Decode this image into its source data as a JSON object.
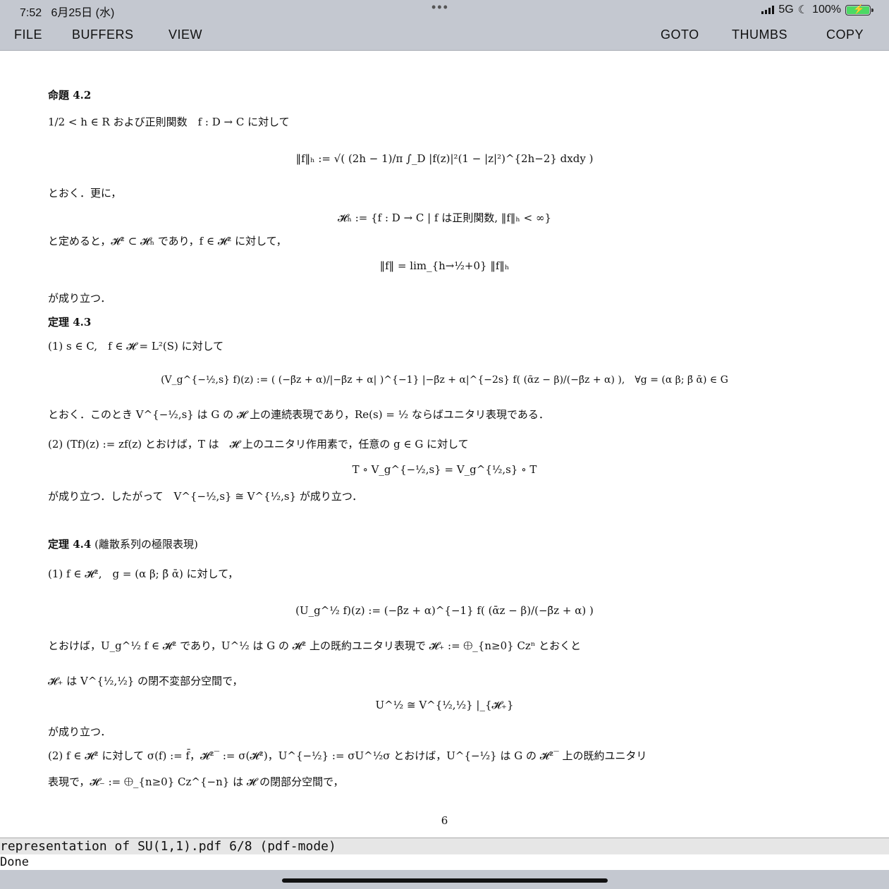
{
  "status": {
    "time": "7:52",
    "date": "6月25日 (水)",
    "network": "5G",
    "battery": "100%",
    "dots": "•••"
  },
  "menu": {
    "file": "FILE",
    "buffers": "BUFFERS",
    "view": "VIEW",
    "goto": "GOTO",
    "thumbs": "THUMBS",
    "copy": "COPY"
  },
  "doc": {
    "prop42_title": "命題 4.2",
    "prop42_line1": "1/2 < h ∈ R および正則関数　f : D → C に対して",
    "eq1": "‖f‖ₕ := √( (2h − 1)/π ∫_D |f(z)|²(1 − |z|²)^{2h−2} dxdy )",
    "text_okusarani": "とおく．更に，",
    "eq2": "𝓗ₕ := {f : D → C | f は正則関数, ‖f‖ₕ < ∞}",
    "text_sadameru": "と定めると，𝓗² ⊂ 𝓗ₕ であり，f ∈ 𝓗² に対して，",
    "eq3": "‖f‖ = lim_{h→½+0} ‖f‖ₕ",
    "text_naritatsu1": "が成り立つ．",
    "thm43_title": "定理 4.3",
    "thm43_1": "(1) s ∈ C,　f ∈ 𝓗 = L²(S) に対して",
    "eq4": "(V_g^{−½,s} f)(z) := ( (−β̄z + α)/|−β̄z + α| )^{−1} |−β̄z + α|^{−2s} f( (ᾱz − β)/(−β̄z + α) ),　∀g = (α β; β̄ ᾱ) ∈ G",
    "text_okukonotoki": "とおく．このとき V^{−½,s} は G の 𝓗 上の連続表現であり，Re(s) = ½ ならばユニタリ表現である．",
    "thm43_2": "(2) (Tf)(z) := zf(z) とおけば，T は　𝓗 上のユニタリ作用素で，任意の g ∈ G に対して",
    "eq5": "T ∘ V_g^{−½,s} = V_g^{½,s} ∘ T",
    "text_shitagatte": "が成り立つ．したがって　V^{−½,s} ≅ V^{½,s} が成り立つ．",
    "thm44_title": "定理 4.4",
    "thm44_sub": "(離散系列の極限表現)",
    "thm44_1": "(1) f ∈ 𝓗²,　g = (α β; β̄ ᾱ) に対して，",
    "eq6": "(U_g^½ f)(z) := (−β̄z + α)^{−1} f( (ᾱz − β)/(−β̄z + α) )",
    "text_okeba": "とおけば，U_g^½ f ∈ 𝓗² であり，U^½ は G の 𝓗² 上の既約ユニタリ表現で 𝓗₊ := ⨁_{n≥0} Czⁿ とおくと",
    "text_heikuu": "𝓗₊ は V^{½,½} の閉不変部分空間で，",
    "eq7": "U^½ ≅ V^{½,½} |_{𝓗₊}",
    "text_naritatsu2": "が成り立つ．",
    "thm44_2": "(2) f ∈ 𝓗² に対して σ(f) := f̄，𝓗²‾ := σ(𝓗²)，U^{−½} := σU^½σ とおけば，U^{−½} は G の 𝓗²‾ 上の既約ユニタリ",
    "text_hyougen": "表現で，𝓗₋ := ⨁_{n≥0} Cz^{−n} は 𝓗 の閉部分空間で，",
    "page_number": "6"
  },
  "modeline": "representation of SU(1,1).pdf 6/8 (pdf-mode)",
  "echo": "Done"
}
